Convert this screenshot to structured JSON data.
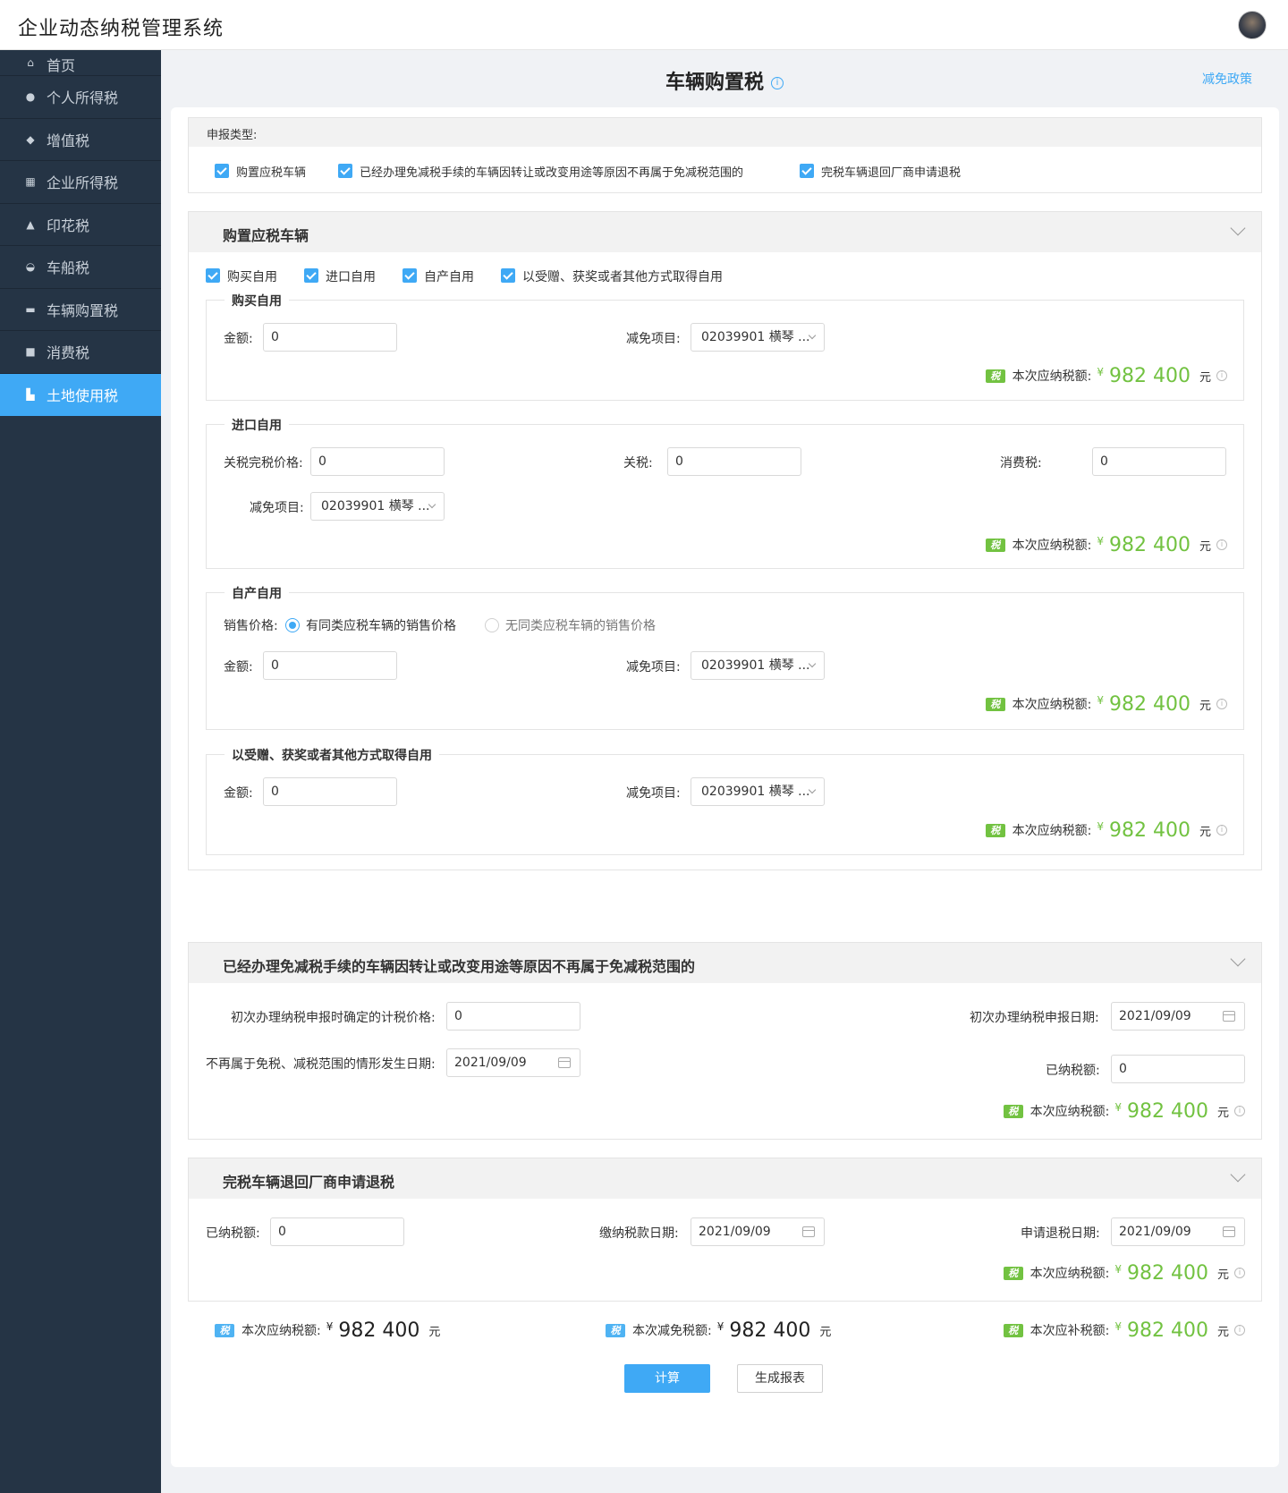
{
  "app": {
    "title": "企业动态纳税管理系统"
  },
  "sidebar": {
    "items": [
      {
        "label": "首页",
        "icon": "home-icon"
      },
      {
        "label": "个人所得税",
        "icon": "user-icon"
      },
      {
        "label": "增值税",
        "icon": "gem-icon"
      },
      {
        "label": "企业所得税",
        "icon": "building-icon"
      },
      {
        "label": "印花税",
        "icon": "stamp-icon"
      },
      {
        "label": "车船税",
        "icon": "ship-icon"
      },
      {
        "label": "车辆购置税",
        "icon": "car-icon"
      },
      {
        "label": "消费税",
        "icon": "bag-icon"
      },
      {
        "label": "土地使用税",
        "icon": "land-icon"
      }
    ],
    "active_index": 8
  },
  "page": {
    "title": "车辆购置税",
    "policy_link": "减免政策"
  },
  "declaration": {
    "label": "申报类型:",
    "options": [
      {
        "label": "购置应税车辆",
        "checked": true
      },
      {
        "label": "已经办理免减税手续的车辆因转让或改变用途等原因不再属于免减税范围的",
        "checked": true
      },
      {
        "label": "完税车辆退回厂商申请退税",
        "checked": true
      }
    ]
  },
  "common": {
    "tax_label": "本次应纳税额:",
    "tax_badge": "税",
    "yen": "¥",
    "unit": "元",
    "tax_amount": "982 400",
    "amount_label": "金额:",
    "relief_label": "减免项目:",
    "relief_value": "02039901 横琴 ..."
  },
  "section1": {
    "title": "购置应税车辆",
    "options": [
      {
        "label": "购买自用",
        "checked": true
      },
      {
        "label": "进口自用",
        "checked": true
      },
      {
        "label": "自产自用",
        "checked": true
      },
      {
        "label": "以受赠、获奖或者其他方式取得自用",
        "checked": true
      }
    ],
    "purchase": {
      "legend": "购买自用",
      "amount": "0"
    },
    "import": {
      "legend": "进口自用",
      "customs_price_label": "关税完税价格:",
      "customs_price": "0",
      "tariff_label": "关税:",
      "tariff": "0",
      "consumption_label": "消费税:",
      "consumption": "0"
    },
    "self_produced": {
      "legend": "自产自用",
      "price_label": "销售价格:",
      "radio_with": "有同类应税车辆的销售价格",
      "radio_without": "无同类应税车辆的销售价格",
      "selected": "with",
      "amount": "0"
    },
    "gift": {
      "legend": "以受赠、获奖或者其他方式取得自用",
      "amount": "0"
    }
  },
  "section2": {
    "title": "已经办理免减税手续的车辆因转让或改变用途等原因不再属于免减税范围的",
    "first_price_label": "初次办理纳税申报时确定的计税价格:",
    "first_price": "0",
    "first_date_label": "初次办理纳税申报日期:",
    "first_date": "2021/09/09",
    "occur_date_label": "不再属于免税、减税范围的情形发生日期:",
    "occur_date": "2021/09/09",
    "paid_label": "已纳税额:",
    "paid": "0"
  },
  "section3": {
    "title": "完税车辆退回厂商申请退税",
    "paid_label": "已纳税额:",
    "paid": "0",
    "pay_date_label": "缴纳税款日期:",
    "pay_date": "2021/09/09",
    "refund_date_label": "申请退税日期:",
    "refund_date": "2021/09/09"
  },
  "summary": {
    "payable_label": "本次应纳税额:",
    "payable": "982 400",
    "relief_label": "本次减免税额:",
    "relief": "982 400",
    "supplement_label": "本次应补税额:",
    "supplement": "982 400"
  },
  "actions": {
    "calculate": "计算",
    "report": "生成报表"
  },
  "colors": {
    "primary": "#3fa9f5",
    "sidebar_bg": "#253445",
    "amount_green": "#72c241"
  }
}
